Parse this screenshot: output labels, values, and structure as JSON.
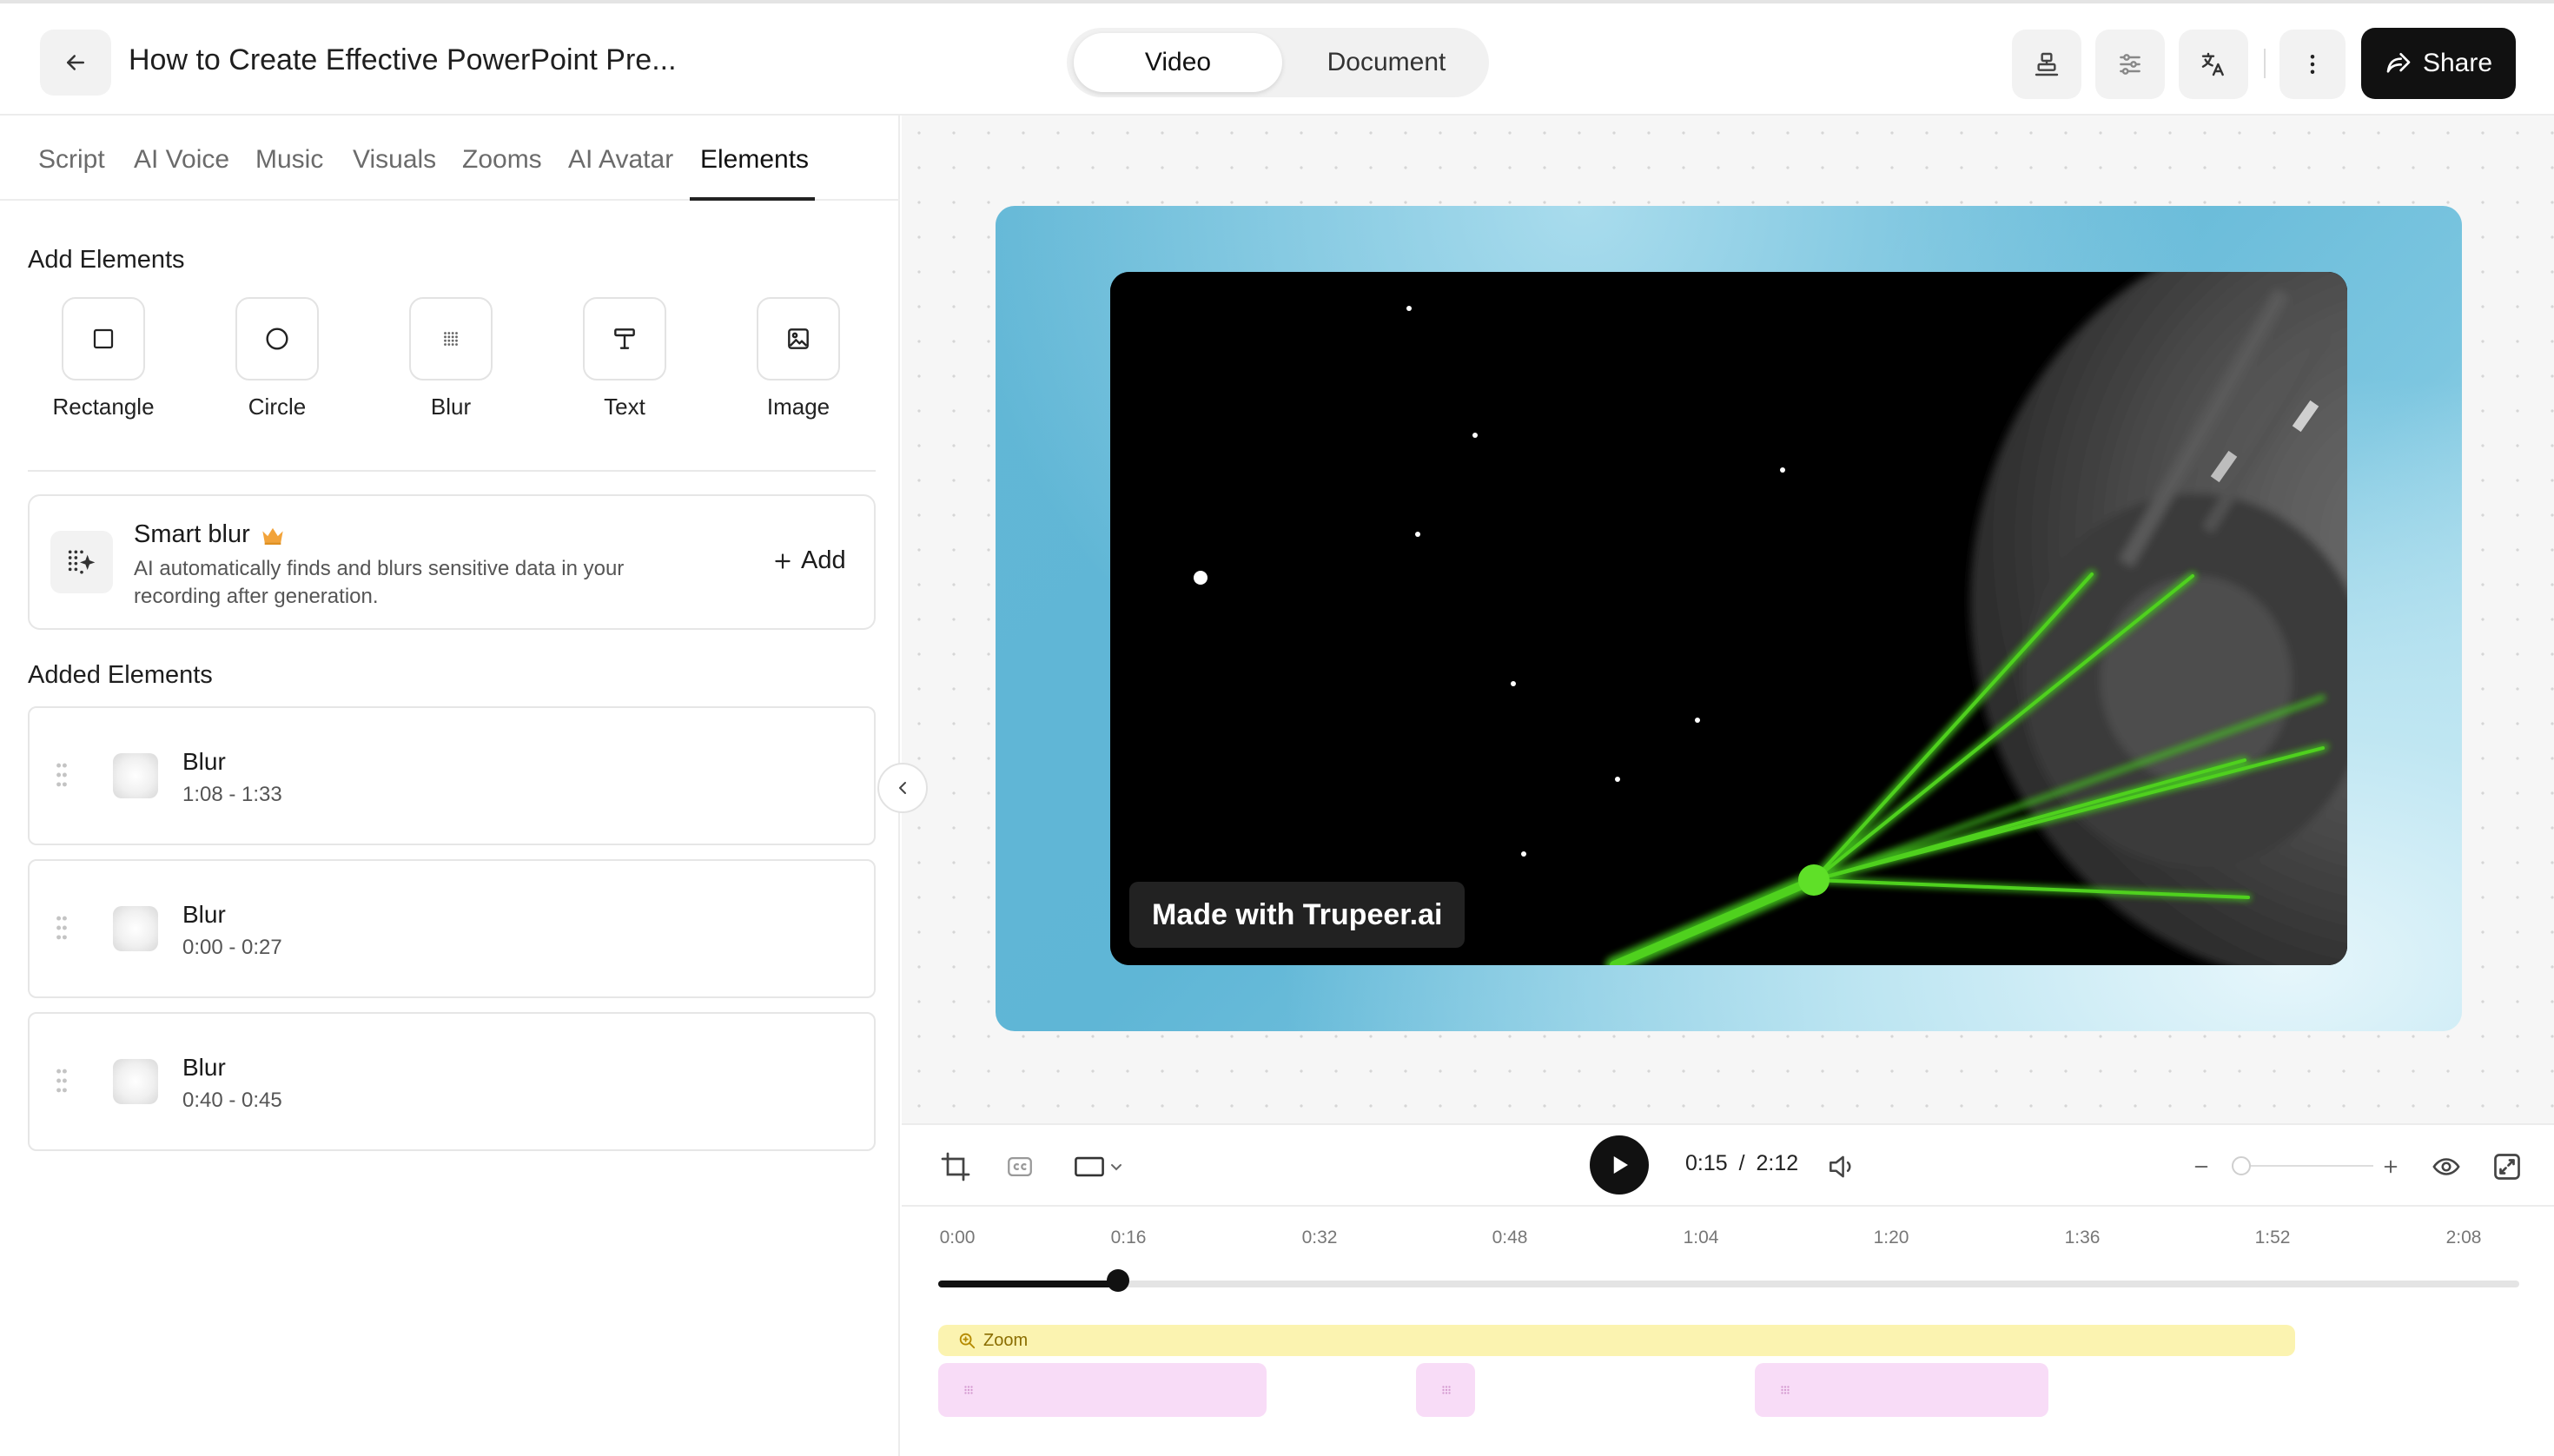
{
  "header": {
    "title": "How to Create Effective PowerPoint Pre...",
    "mode_video": "Video",
    "mode_document": "Document",
    "share_label": "Share"
  },
  "tabs": [
    "Script",
    "AI Voice",
    "Music",
    "Visuals",
    "Zooms",
    "AI Avatar",
    "Elements"
  ],
  "active_tab": "Elements",
  "add_elements": {
    "title": "Add Elements",
    "items": [
      {
        "label": "Rectangle",
        "icon": "square-icon"
      },
      {
        "label": "Circle",
        "icon": "circle-icon"
      },
      {
        "label": "Blur",
        "icon": "blur-icon"
      },
      {
        "label": "Text",
        "icon": "text-icon"
      },
      {
        "label": "Image",
        "icon": "image-icon"
      }
    ]
  },
  "smart_blur": {
    "title": "Smart blur",
    "description": "AI automatically finds and blurs sensitive data in your recording after generation.",
    "add_label": "Add"
  },
  "added_elements": {
    "title": "Added Elements",
    "items": [
      {
        "name": "Blur",
        "range": "1:08 - 1:33"
      },
      {
        "name": "Blur",
        "range": "0:00 - 0:27"
      },
      {
        "name": "Blur",
        "range": "0:40 - 0:45"
      }
    ]
  },
  "video": {
    "watermark": "Made with Trupeer.ai"
  },
  "player": {
    "current_time": "0:15",
    "separator": "/",
    "total_time": "2:12",
    "progress_fraction": 0.114,
    "zoom_level_fraction": 0.0
  },
  "timeline": {
    "ticks": [
      "0:00",
      "0:16",
      "0:32",
      "0:48",
      "1:04",
      "1:20",
      "1:36",
      "1:52",
      "2:08"
    ],
    "zoom_label": "Zoom"
  },
  "colors": {
    "accent": "#111111",
    "zoom_track": "#fbf3b0",
    "blur_segment": "#f8dcf7",
    "crown": "#f2a33a"
  }
}
